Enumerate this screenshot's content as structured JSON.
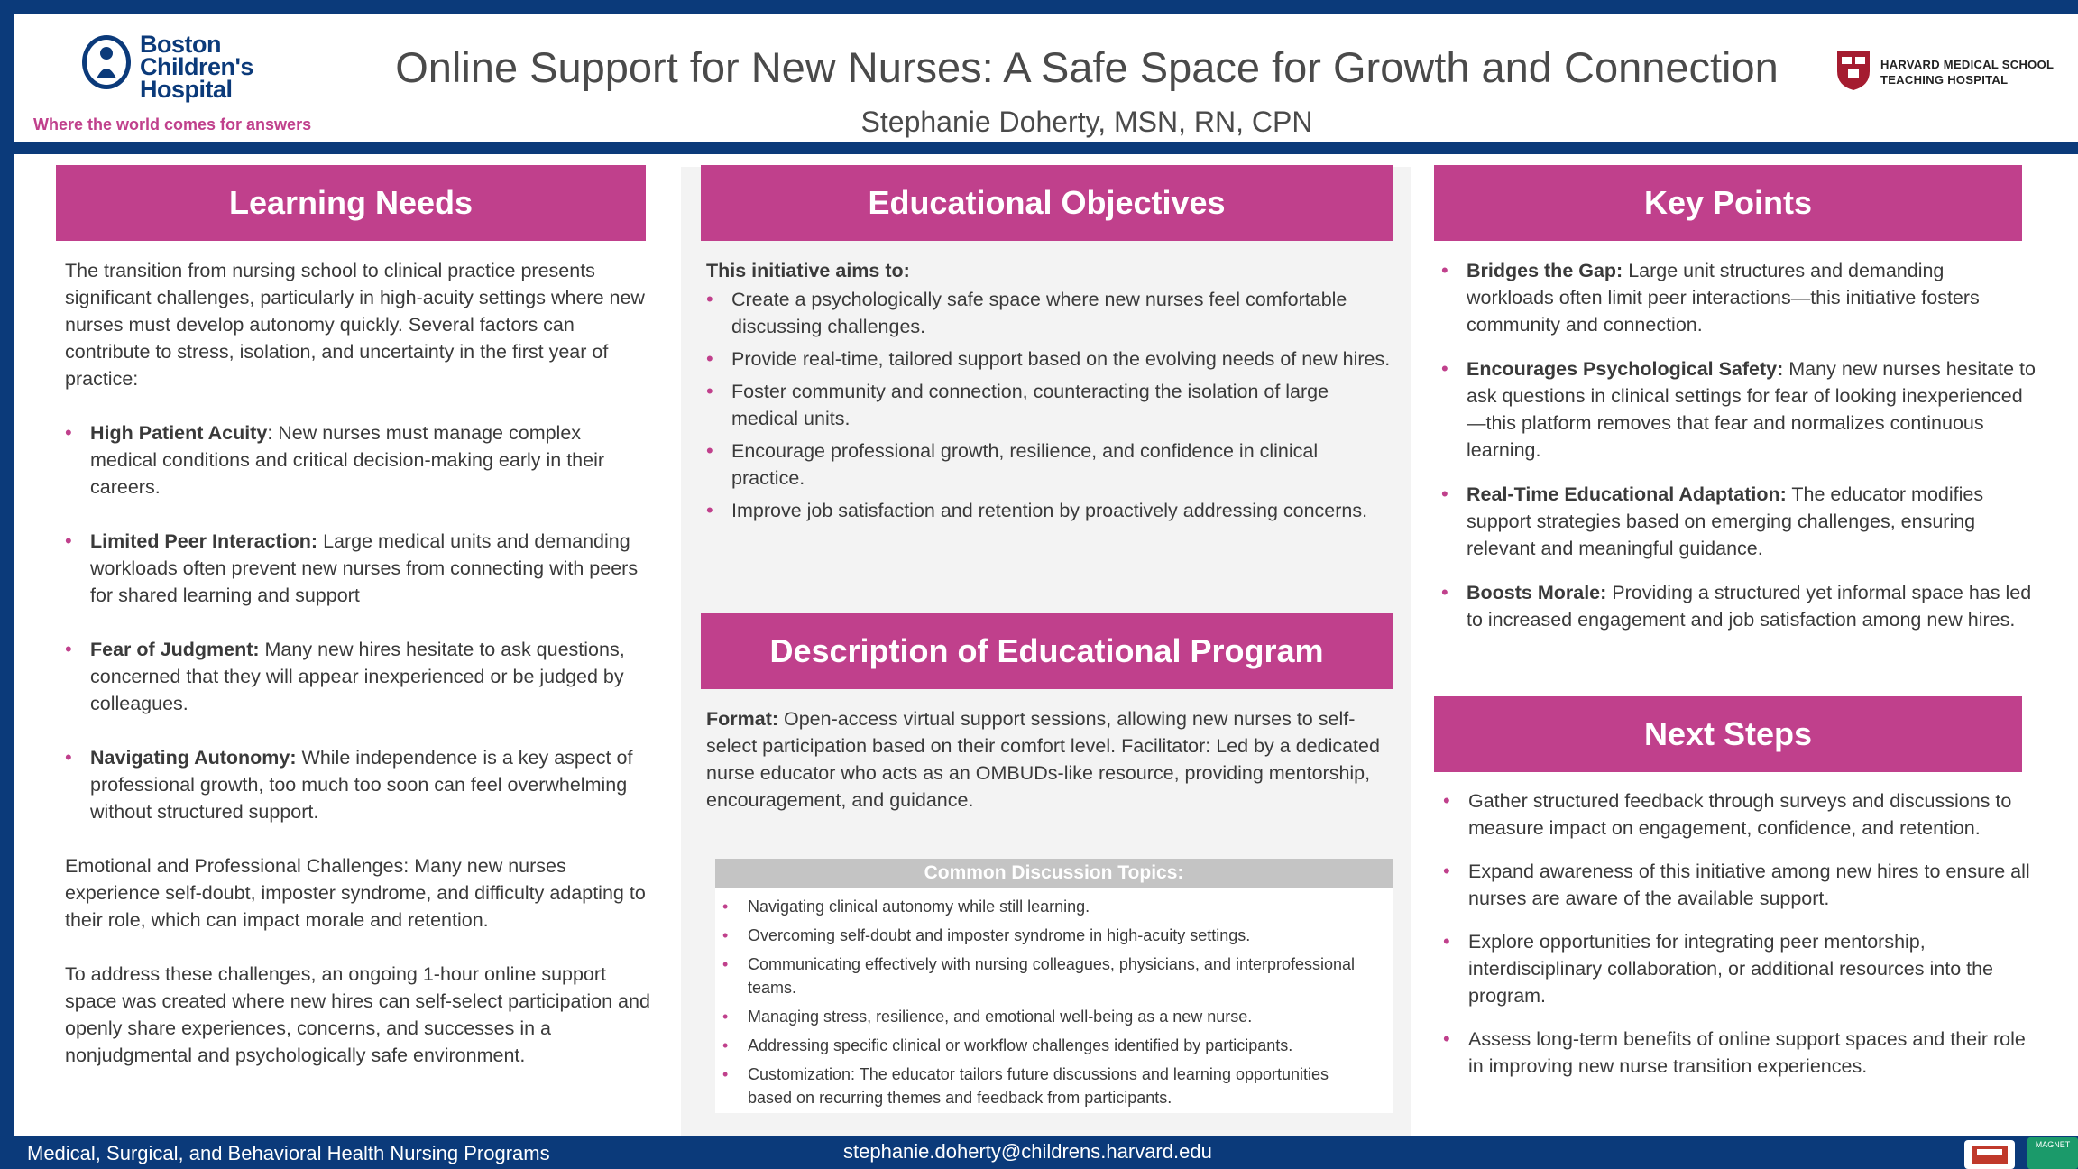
{
  "header": {
    "org_name_line1": "Boston",
    "org_name_line2": "Children's",
    "org_name_line3": "Hospital",
    "tagline": "Where the world comes for answers",
    "title": "Online Support for New Nurses: A Safe Space for Growth and Connection",
    "author": "Stephanie Doherty, MSN, RN, CPN",
    "hms_line1": "HARVARD MEDICAL SCHOOL",
    "hms_line2": "TEACHING HOSPITAL"
  },
  "learning_needs": {
    "heading": "Learning Needs",
    "intro": "The transition from nursing school to clinical practice presents significant challenges, particularly in high-acuity settings where new nurses must develop autonomy quickly. Several factors can contribute to stress, isolation, and uncertainty in the first year of practice:",
    "items": [
      {
        "bold": "High Patient Acuity",
        "text": ": New nurses must manage complex medical conditions and critical decision-making early in their careers."
      },
      {
        "bold": "Limited Peer Interaction:",
        "text": " Large medical units and demanding workloads often prevent new nurses from connecting with peers for shared learning and support"
      },
      {
        "bold": "Fear of Judgment:",
        "text": " Many new hires hesitate to ask questions, concerned that they will appear inexperienced or be judged by colleagues."
      },
      {
        "bold": "Navigating Autonomy:",
        "text": " While independence is a key aspect of professional growth, too much too soon can feel overwhelming without structured support."
      }
    ],
    "para2": "Emotional and Professional Challenges: Many new nurses experience self-doubt, imposter syndrome, and difficulty adapting to their role, which can impact morale and retention.",
    "para3": "To address these challenges, an ongoing 1-hour online support space was created where new hires can self-select participation and openly share experiences, concerns, and successes in a nonjudgmental and psychologically safe environment."
  },
  "objectives": {
    "heading": "Educational Objectives",
    "lead": "This initiative aims to:",
    "items": [
      "Create a psychologically safe space where new nurses feel comfortable discussing challenges.",
      "Provide real-time, tailored support based on the evolving needs of new hires.",
      "Foster community and connection, counteracting the isolation of large medical units.",
      "Encourage professional growth, resilience, and confidence in clinical practice.",
      "Improve job satisfaction and retention by proactively addressing concerns."
    ]
  },
  "program": {
    "heading": "Description of Educational Program",
    "format_label": "Format:",
    "format_text": " Open-access virtual support sessions, allowing new nurses to self-select participation based on their comfort level. Facilitator: Led by a dedicated nurse educator who acts as an OMBUDs-like resource, providing mentorship, encouragement, and guidance.",
    "topics_heading": "Common Discussion Topics:",
    "topics": [
      "Navigating clinical autonomy while still learning.",
      "Overcoming self-doubt and imposter syndrome in high-acuity settings.",
      "Communicating effectively with nursing colleagues, physicians, and interprofessional teams.",
      "Managing stress, resilience, and emotional well-being as a new nurse.",
      "Addressing specific clinical or workflow challenges identified by participants.",
      "Customization: The educator tailors future discussions and learning opportunities based on recurring themes and feedback from participants."
    ]
  },
  "key_points": {
    "heading": "Key Points",
    "items": [
      {
        "bold": "Bridges the Gap:",
        "text": " Large unit structures and demanding workloads often limit peer interactions—this initiative fosters community and connection."
      },
      {
        "bold": "Encourages Psychological Safety:",
        "text": " Many new nurses hesitate to ask questions in clinical settings for fear of looking inexperienced—this platform removes that fear and normalizes continuous learning."
      },
      {
        "bold": "Real-Time Educational Adaptation:",
        "text": " The educator modifies support strategies based on emerging challenges, ensuring relevant and meaningful guidance."
      },
      {
        "bold": "Boosts Morale:",
        "text": " Providing a structured yet informal space has led to increased engagement and job satisfaction among new hires."
      }
    ]
  },
  "next_steps": {
    "heading": "Next Steps",
    "items": [
      "Gather structured feedback through surveys and discussions to measure impact on engagement, confidence, and retention.",
      "Expand awareness of this initiative among new hires to ensure all nurses are aware of the available support.",
      "Explore opportunities for integrating peer mentorship, interdisciplinary collaboration, or additional resources into the program.",
      "Assess long-term benefits of online support spaces and their role in improving new nurse transition experiences."
    ]
  },
  "footer": {
    "left": "Medical, Surgical, and Behavioral Health Nursing Programs",
    "email": "stephanie.doherty@childrens.harvard.edu",
    "badge_text": "MAGNET"
  },
  "colors": {
    "navy": "#0b3a7a",
    "magenta": "#c0408c",
    "panel_grey": "#f3f3f3"
  }
}
